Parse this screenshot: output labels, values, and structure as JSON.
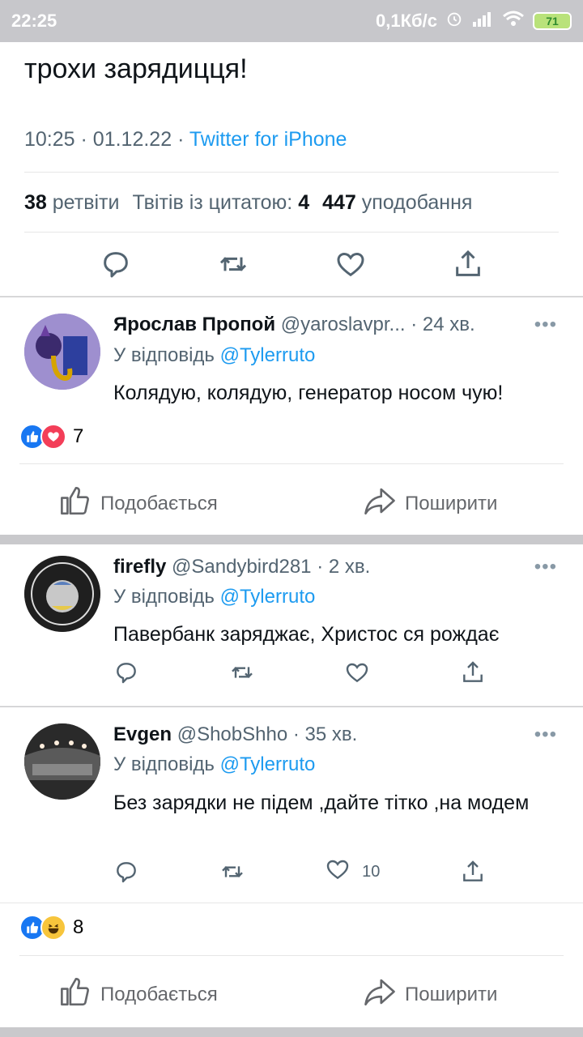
{
  "status_bar": {
    "time": "22:25",
    "speed": "0,1Кб/с",
    "battery": "71"
  },
  "tweet": {
    "text_tail": "трохи зарядицця!",
    "time": "10:25",
    "date": "01.12.22",
    "source": "Twitter for iPhone",
    "retweets_count": "38",
    "retweets_label": "ретвіти",
    "quotes_label": "Твітів із цитатою:",
    "quotes_count": "4",
    "likes_count": "447",
    "likes_label": "уподобання"
  },
  "replies": [
    {
      "name": "Ярослав Пропой",
      "handle": "@yaroslavpr...",
      "time": "· 24 хв.",
      "reply_prefix": "У відповідь",
      "reply_to": "@Tylerruto",
      "text": "Колядую, колядую, генератор носом чую!"
    },
    {
      "name": "firefly",
      "handle": "@Sandybird281",
      "time": "· 2 хв.",
      "reply_prefix": "У відповідь",
      "reply_to": "@Tylerruto",
      "text": "Павербанк заряджає, Христос ся рождає"
    },
    {
      "name": "Evgen",
      "handle": "@ShobShho",
      "time": "· 35 хв.",
      "reply_prefix": "У відповідь",
      "reply_to": "@Tylerruto",
      "text": "Без зарядки не підем ,дайте тітко ,на модем",
      "likes": "10"
    }
  ],
  "fb_block_1": {
    "reactions_count": "7",
    "like_label": "Подобається",
    "share_label": "Поширити"
  },
  "fb_block_2": {
    "reactions_count": "8",
    "like_label": "Подобається",
    "share_label": "Поширити"
  },
  "more_label": "•••",
  "colors": {
    "twitter_blue": "#1d9bf0",
    "text_gray": "#536471",
    "fb_blue": "#1877f2",
    "fb_red": "#f33e58"
  }
}
